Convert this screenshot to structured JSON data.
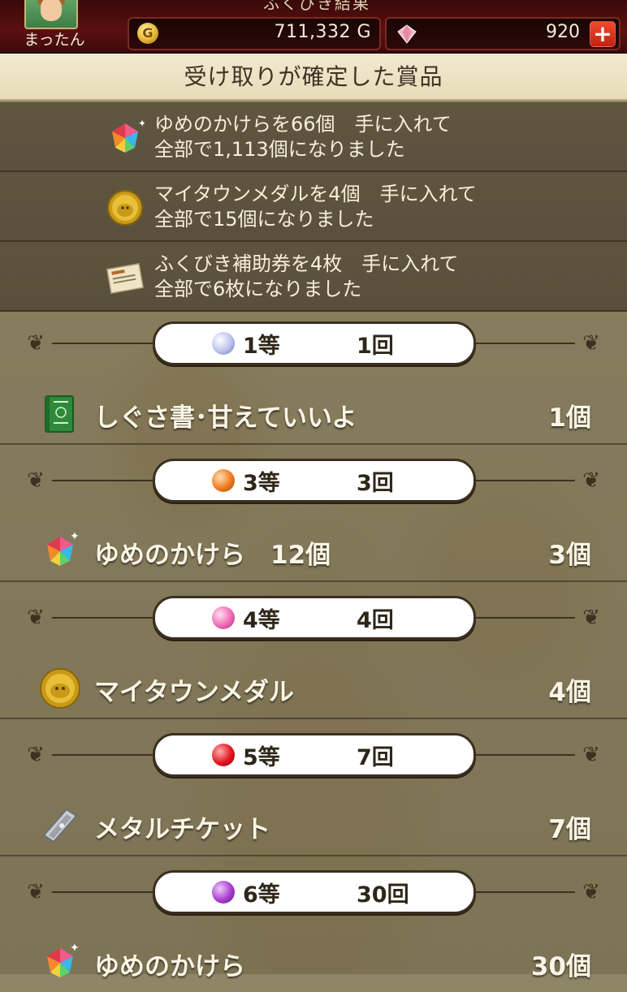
{
  "header": {
    "title_partial": "ふくびき結果",
    "player_name": "まったん",
    "gold_icon_label": "G",
    "gold_value": "711,332 G",
    "gem_value": "920",
    "plus_label": "+"
  },
  "section_title": "受け取りが確定した賞品",
  "confirmed_items": [
    {
      "icon": "dream-shard-icon",
      "line1": "ゆめのかけらを66個　手に入れて",
      "line2": "全部で1,113個になりました"
    },
    {
      "icon": "mytown-medal-icon",
      "line1": "マイタウンメダルを4個　手に入れて",
      "line2": "全部で15個になりました"
    },
    {
      "icon": "lottery-ticket-icon",
      "line1": "ふくびき補助券を4枚　手に入れて",
      "line2": "全部で6枚になりました"
    }
  ],
  "ranks": [
    {
      "label": "1等",
      "count": "1回",
      "orb_color": "#b9c2ea",
      "item_icon": "green-book-icon",
      "item_name": "しぐさ書･甘えていいよ",
      "item_qty": "1個"
    },
    {
      "label": "3等",
      "count": "3回",
      "orb_color": "#f07a1e",
      "item_icon": "dream-shard-icon",
      "item_name": "ゆめのかけら　12個",
      "item_qty": "3個"
    },
    {
      "label": "4等",
      "count": "4回",
      "orb_color": "#f06ab4",
      "item_icon": "mytown-medal-icon",
      "item_name": "マイタウンメダル",
      "item_qty": "4個"
    },
    {
      "label": "5等",
      "count": "7回",
      "orb_color": "#e3141e",
      "item_icon": "metal-ticket-icon",
      "item_name": "メタルチケット",
      "item_qty": "7個"
    },
    {
      "label": "6等",
      "count": "30回",
      "orb_color": "#a83fd0",
      "item_icon": "dream-shard-icon",
      "item_name": "ゆめのかけら",
      "item_qty": "30個"
    }
  ]
}
